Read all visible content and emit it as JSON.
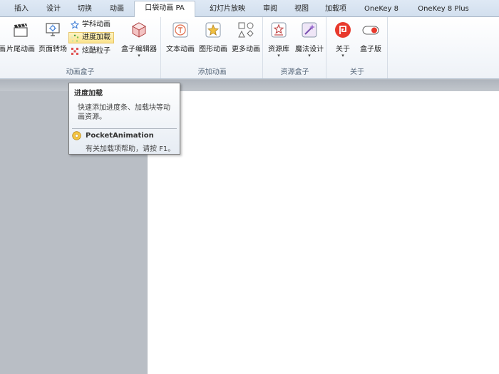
{
  "tabs": [
    {
      "label": "插入",
      "active": false
    },
    {
      "label": "设计",
      "active": false
    },
    {
      "label": "切换",
      "active": false
    },
    {
      "label": "动画",
      "active": false
    },
    {
      "label": "口袋动画 PA",
      "active": true
    },
    {
      "label": "幻灯片放映",
      "active": false
    },
    {
      "label": "审阅",
      "active": false
    },
    {
      "label": "视图",
      "active": false
    },
    {
      "label": "加载项",
      "active": false
    },
    {
      "label": "OneKey 8",
      "active": false
    },
    {
      "label": "OneKey 8 Plus",
      "active": false
    }
  ],
  "groups": {
    "anim_box": {
      "label": "动画盒子",
      "buttons": {
        "cut": "画",
        "ending": "片尾动画",
        "page_turn": "页面转场",
        "subject": "学科动画",
        "loading": "进度加载",
        "particles": "炫酷粒子",
        "box_editor": "盒子编辑器"
      }
    },
    "add_anim": {
      "label": "添加动画",
      "buttons": {
        "text": "文本动画",
        "shape": "图形动画",
        "more": "更多动画"
      }
    },
    "resource_box": {
      "label": "资源盒子",
      "buttons": {
        "library": "资源库",
        "magic": "魔法设计"
      }
    },
    "about": {
      "label": "关于",
      "buttons": {
        "about": "关于",
        "box_edition": "盒子版"
      }
    }
  },
  "tooltip": {
    "title": "进度加载",
    "description": "快速添加进度条、加载块等动画资源。",
    "help_title": "PocketAnimation",
    "help_text": "有关加载项帮助，请按 F1。"
  },
  "colors": {
    "about_icon": "#e8392c",
    "toggle_accent": "#e8392c",
    "highlight": "#fbe38d"
  }
}
